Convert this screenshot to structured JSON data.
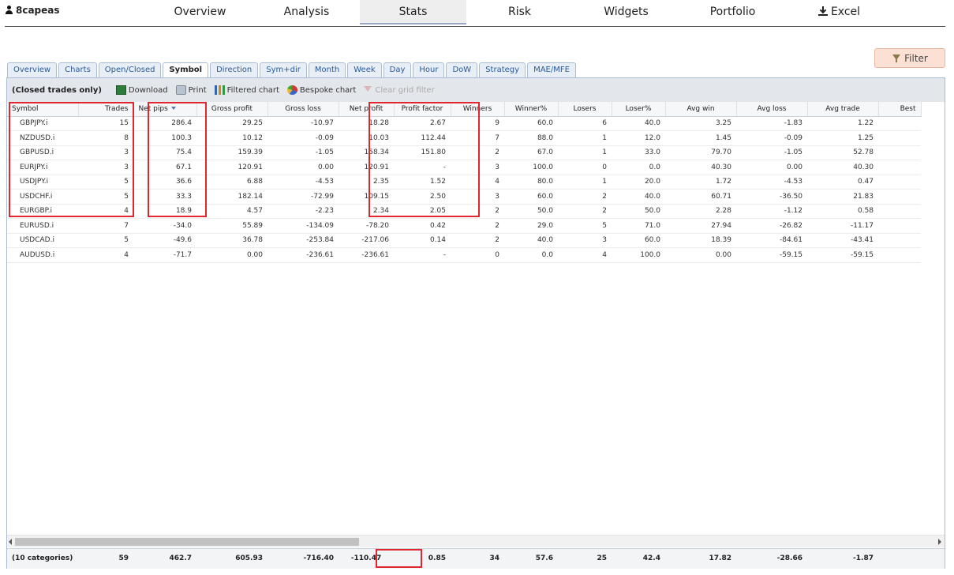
{
  "user": {
    "name": "8capeas"
  },
  "nav": [
    {
      "label": "Overview"
    },
    {
      "label": "Analysis"
    },
    {
      "label": "Stats"
    },
    {
      "label": "Risk"
    },
    {
      "label": "Widgets"
    },
    {
      "label": "Portfolio"
    },
    {
      "label": "Excel"
    }
  ],
  "nav_active": "Stats",
  "filter_button": {
    "label": "Filter"
  },
  "subtabs": [
    "Overview",
    "Charts",
    "Open/Closed",
    "Symbol",
    "Direction",
    "Sym+dir",
    "Month",
    "Week",
    "Day",
    "Hour",
    "DoW",
    "Strategy",
    "MAE/MFE"
  ],
  "subtab_active": "Symbol",
  "toolbar": {
    "title": "(Closed trades only)",
    "download": "Download",
    "print": "Print",
    "filtered_chart": "Filtered chart",
    "bespoke_chart": "Bespoke chart",
    "clear_filter": "Clear grid filter"
  },
  "columns": [
    "Symbol",
    "Trades",
    "Net pips",
    "Gross profit",
    "Gross loss",
    "Net profit",
    "Profit factor",
    "Winners",
    "Winner%",
    "Losers",
    "Loser%",
    "Avg win",
    "Avg loss",
    "Avg trade",
    "Best"
  ],
  "rows": [
    [
      "GBPJPY.i",
      "15",
      "286.4",
      "29.25",
      "-10.97",
      "18.28",
      "2.67",
      "9",
      "60.0",
      "6",
      "40.0",
      "3.25",
      "-1.83",
      "1.22",
      ""
    ],
    [
      "NZDUSD.i",
      "8",
      "100.3",
      "10.12",
      "-0.09",
      "10.03",
      "112.44",
      "7",
      "88.0",
      "1",
      "12.0",
      "1.45",
      "-0.09",
      "1.25",
      ""
    ],
    [
      "GBPUSD.i",
      "3",
      "75.4",
      "159.39",
      "-1.05",
      "158.34",
      "151.80",
      "2",
      "67.0",
      "1",
      "33.0",
      "79.70",
      "-1.05",
      "52.78",
      ""
    ],
    [
      "EURJPY.i",
      "3",
      "67.1",
      "120.91",
      "0.00",
      "120.91",
      "-",
      "3",
      "100.0",
      "0",
      "0.0",
      "40.30",
      "0.00",
      "40.30",
      ""
    ],
    [
      "USDJPY.i",
      "5",
      "36.6",
      "6.88",
      "-4.53",
      "2.35",
      "1.52",
      "4",
      "80.0",
      "1",
      "20.0",
      "1.72",
      "-4.53",
      "0.47",
      ""
    ],
    [
      "USDCHF.i",
      "5",
      "33.3",
      "182.14",
      "-72.99",
      "109.15",
      "2.50",
      "3",
      "60.0",
      "2",
      "40.0",
      "60.71",
      "-36.50",
      "21.83",
      ""
    ],
    [
      "EURGBP.i",
      "4",
      "18.9",
      "4.57",
      "-2.23",
      "2.34",
      "2.05",
      "2",
      "50.0",
      "2",
      "50.0",
      "2.28",
      "-1.12",
      "0.58",
      ""
    ],
    [
      "EURUSD.i",
      "7",
      "-34.0",
      "55.89",
      "-134.09",
      "-78.20",
      "0.42",
      "2",
      "29.0",
      "5",
      "71.0",
      "27.94",
      "-26.82",
      "-11.17",
      ""
    ],
    [
      "USDCAD.i",
      "5",
      "-49.6",
      "36.78",
      "-253.84",
      "-217.06",
      "0.14",
      "2",
      "40.0",
      "3",
      "60.0",
      "18.39",
      "-84.61",
      "-43.41",
      ""
    ],
    [
      "AUDUSD.i",
      "4",
      "-71.7",
      "0.00",
      "-236.61",
      "-236.61",
      "-",
      "0",
      "0.0",
      "4",
      "100.0",
      "0.00",
      "-59.15",
      "-59.15",
      ""
    ]
  ],
  "totals": [
    "(10 categories)",
    "59",
    "462.7",
    "605.93",
    "-716.40",
    "-110.47",
    "0.85",
    "34",
    "57.6",
    "25",
    "42.4",
    "17.82",
    "-28.66",
    "-1.87",
    ""
  ],
  "colors": {
    "highlight": "#e0262e",
    "filter_bg": "#fde0d4",
    "tab_text": "#2a5a9a"
  }
}
